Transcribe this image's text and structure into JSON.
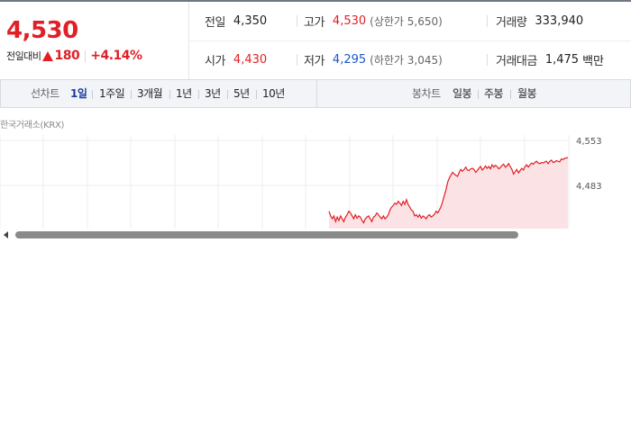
{
  "quote": {
    "price": "4,530",
    "change_label": "전일대비",
    "change_amount": "180",
    "change_percent": "+4.14%",
    "stats": {
      "prev_close": {
        "label": "전일",
        "value": "4,350"
      },
      "high": {
        "label": "고가",
        "value": "4,530"
      },
      "upper_limit": {
        "label": "(상한가",
        "value": "5,650)"
      },
      "volume": {
        "label": "거래량",
        "value": "333,940"
      },
      "open": {
        "label": "시가",
        "value": "4,430"
      },
      "low": {
        "label": "저가",
        "value": "4,295"
      },
      "lower_limit": {
        "label": "(하한가",
        "value": "3,045)"
      },
      "trade_value": {
        "label": "거래대금",
        "value": "1,475",
        "unit": "백만"
      }
    }
  },
  "toolbar": {
    "line_chart_label": "선차트",
    "line_chart_periods": [
      "1일",
      "1주일",
      "3개월",
      "1년",
      "3년",
      "5년",
      "10년"
    ],
    "active_period": "1일",
    "candle_chart_label": "봉차트",
    "candle_chart_periods": [
      "일봉",
      "주봉",
      "월봉"
    ]
  },
  "chart_source": "한국거래소(KRX)",
  "colors": {
    "up": "#e01f26",
    "down": "#1a57c9",
    "active": "#1d3d9c"
  },
  "chart_data": {
    "type": "line",
    "title": "",
    "xlabel": "",
    "ylabel": "",
    "y_ticks": [
      "4,553",
      "4,483"
    ],
    "ylim": [
      4405,
      4560
    ],
    "x": [
      0,
      1,
      2,
      3,
      4,
      5,
      6,
      7,
      8,
      9,
      10,
      11,
      12,
      13,
      14,
      15,
      16,
      17,
      18,
      19,
      20,
      21,
      22,
      23,
      24,
      25,
      26,
      27,
      28,
      29,
      30,
      31,
      32,
      33,
      34,
      35,
      36,
      37,
      38,
      39,
      40,
      41,
      42,
      43,
      44,
      45,
      46,
      47,
      48,
      49,
      50,
      51,
      52,
      53,
      54,
      55,
      56,
      57,
      58,
      59,
      60,
      61,
      62,
      63,
      64,
      65,
      66,
      67,
      68,
      69,
      70,
      71,
      72,
      73,
      74,
      75,
      76,
      77,
      78,
      79,
      80,
      81,
      82,
      83,
      84,
      85,
      86,
      87,
      88,
      89,
      90,
      91,
      92,
      93,
      94,
      95,
      96,
      97,
      98,
      99,
      100,
      101,
      102,
      103,
      104,
      105,
      106,
      107,
      108,
      109,
      110,
      111,
      112,
      113,
      114,
      115,
      116,
      117,
      118,
      119,
      120,
      121,
      122,
      123,
      124,
      125,
      126,
      127,
      128,
      129,
      130,
      131,
      132,
      133,
      134,
      135,
      136,
      137,
      138,
      139,
      140,
      141,
      142,
      143,
      144,
      145
    ],
    "series": [
      {
        "values": [
          4438,
          4430,
          4425,
          4430,
          4420,
          4428,
          4422,
          4430,
          4425,
          4420,
          4428,
          4432,
          4438,
          4435,
          4430,
          4425,
          4432,
          4426,
          4430,
          4428,
          4422,
          4418,
          4425,
          4428,
          4430,
          4425,
          4420,
          4428,
          4430,
          4435,
          4432,
          4428,
          4425,
          4430,
          4425,
          4428,
          4432,
          4440,
          4445,
          4448,
          4452,
          4450,
          4455,
          4452,
          4448,
          4455,
          4450,
          4458,
          4450,
          4445,
          4440,
          4438,
          4430,
          4432,
          4428,
          4432,
          4426,
          4430,
          4428,
          4425,
          4430,
          4432,
          4428,
          4430,
          4433,
          4438,
          4435,
          4440,
          4446,
          4455,
          4465,
          4475,
          4488,
          4495,
          4500,
          4505,
          4502,
          4500,
          4498,
          4505,
          4510,
          4507,
          4510,
          4514,
          4509,
          4508,
          4511,
          4512,
          4510,
          4505,
          4508,
          4512,
          4515,
          4509,
          4512,
          4516,
          4512,
          4515,
          4511,
          4518,
          4514,
          4517,
          4515,
          4511,
          4513,
          4517,
          4519,
          4514,
          4516,
          4520,
          4515,
          4510,
          4502,
          4506,
          4510,
          4504,
          4508,
          4512,
          4509,
          4515,
          4518,
          4514,
          4518,
          4521,
          4519,
          4522,
          4524,
          4521,
          4520,
          4522,
          4521,
          4523,
          4524,
          4520,
          4524,
          4526,
          4522,
          4523,
          4525,
          4524,
          4523,
          4528,
          4527,
          4529,
          4530,
          4530
        ]
      }
    ],
    "grid": true
  }
}
